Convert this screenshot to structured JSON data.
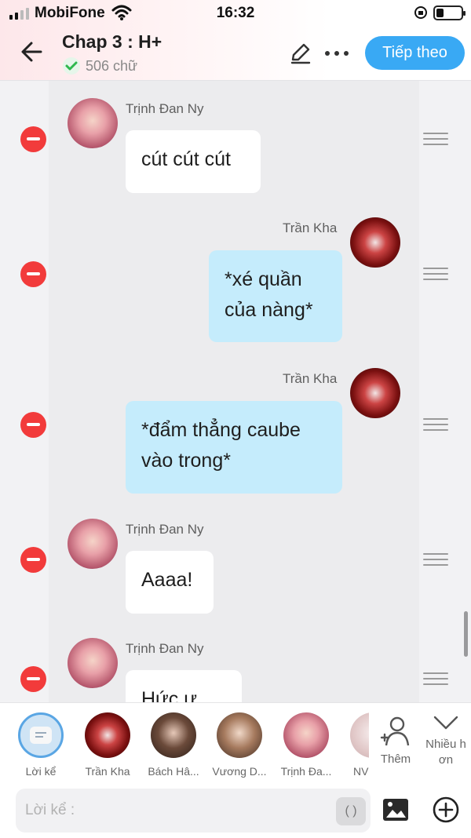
{
  "status_bar": {
    "carrier": "MobiFone",
    "time": "16:32"
  },
  "header": {
    "title": "Chap 3 : H+",
    "word_count": "506 chữ",
    "next_button": "Tiếp theo"
  },
  "messages": [
    {
      "sender": "Trịnh Đan Ny",
      "text": "cút cút cút",
      "side": "left"
    },
    {
      "sender": "Trần Kha",
      "lines": [
        "*xé quần",
        "của nàng*"
      ],
      "side": "right"
    },
    {
      "sender": "Trần Kha",
      "lines": [
        "*đẩm thẳng caube",
        "vào trong*"
      ],
      "side": "right"
    },
    {
      "sender": "Trịnh Đan Ny",
      "text": "Aaaa!",
      "side": "left"
    },
    {
      "sender": "Trịnh Đan Ny",
      "text": "Hức ư",
      "side": "left"
    }
  ],
  "characters": [
    {
      "label": "Lời kể"
    },
    {
      "label": "Trần Kha"
    },
    {
      "label": "Bách Hâ..."
    },
    {
      "label": "Vương D..."
    },
    {
      "label": "Trịnh Đa..."
    },
    {
      "label": "NV"
    }
  ],
  "actions": {
    "add_label": "Thêm",
    "multi_line1": "Nhiều h",
    "multi_line2": "ơn"
  },
  "composer": {
    "placeholder": "Lời kể :",
    "paren": "( )"
  },
  "colors": {
    "accent": "#39a9f4",
    "delete": "#f23b3b",
    "bubble_right": "#c5ecfc",
    "bubble_left": "#ffffff"
  }
}
